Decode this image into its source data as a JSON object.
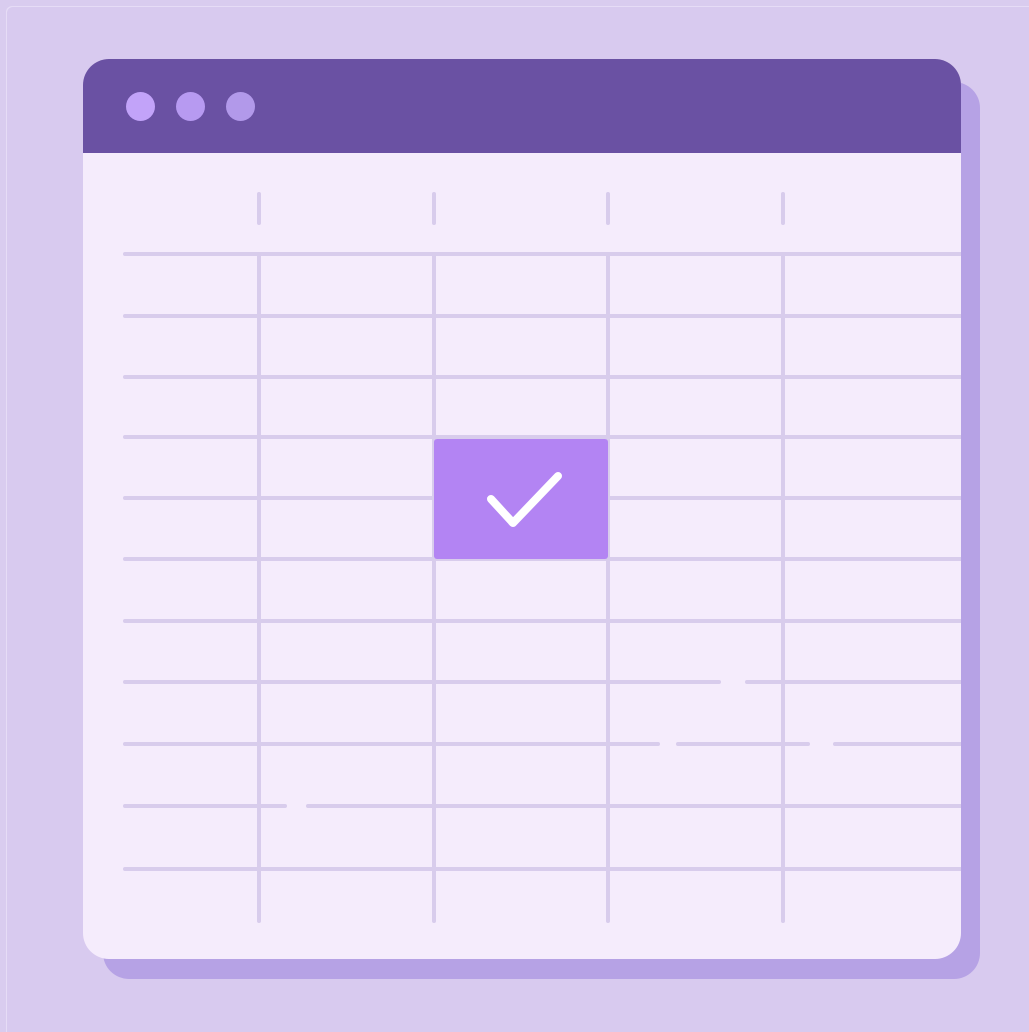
{
  "colors": {
    "page_background": "#d9ccef",
    "window_background": "#f5ecfc",
    "titlebar": "#6a51a3",
    "window_shadow": "#b6a2e5",
    "grid_lines": "#d8ccec",
    "selected_cell": "#b384f3",
    "check_mark": "#ffffff"
  },
  "window": {
    "controls": [
      {
        "name": "close-dot",
        "color": "#c2a3f9"
      },
      {
        "name": "minimize-dot",
        "color": "#b79af1"
      },
      {
        "name": "maximize-dot",
        "color": "#b299ea"
      }
    ]
  },
  "spreadsheet": {
    "columns": 5,
    "rows": 10,
    "selected_cell": {
      "column": 3,
      "row": 4,
      "icon": "check-icon"
    }
  }
}
